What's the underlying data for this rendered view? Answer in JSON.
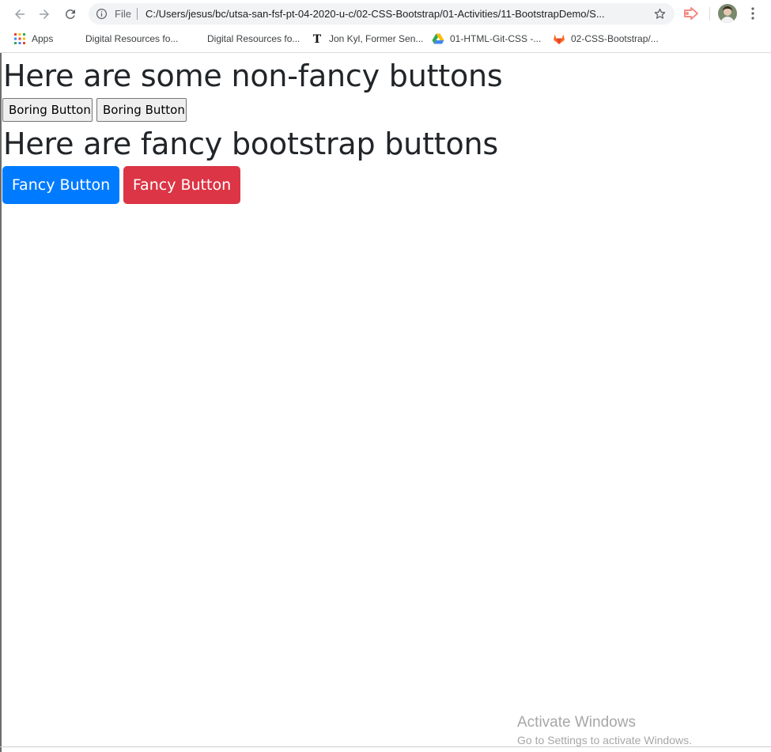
{
  "browser": {
    "scheme_label": "File",
    "url": "C:/Users/jesus/bc/utsa-san-fsf-pt-04-2020-u-c/02-CSS-Bootstrap/01-Activities/11-BootstrapDemo/S...",
    "bookmarks": [
      {
        "label": "Apps",
        "icon": "apps-grid-icon"
      },
      {
        "label": "Digital Resources fo...",
        "icon": "none"
      },
      {
        "label": "Digital Resources fo...",
        "icon": "none"
      },
      {
        "label": "Jon Kyl, Former Sen...",
        "icon": "nyt-icon"
      },
      {
        "label": "01-HTML-Git-CSS -...",
        "icon": "google-drive-icon"
      },
      {
        "label": "02-CSS-Bootstrap/...",
        "icon": "gitlab-icon"
      }
    ]
  },
  "page": {
    "heading_plain": "Here are some non-fancy buttons",
    "boring_buttons": [
      "Boring Button",
      "Boring Button"
    ],
    "heading_fancy": "Here are fancy bootstrap buttons",
    "fancy_buttons": [
      {
        "label": "Fancy Button",
        "color": "#007bff"
      },
      {
        "label": "Fancy Button",
        "color": "#dc3545"
      }
    ]
  },
  "watermark": {
    "title": "Activate Windows",
    "subtitle": "Go to Settings to activate Windows."
  }
}
